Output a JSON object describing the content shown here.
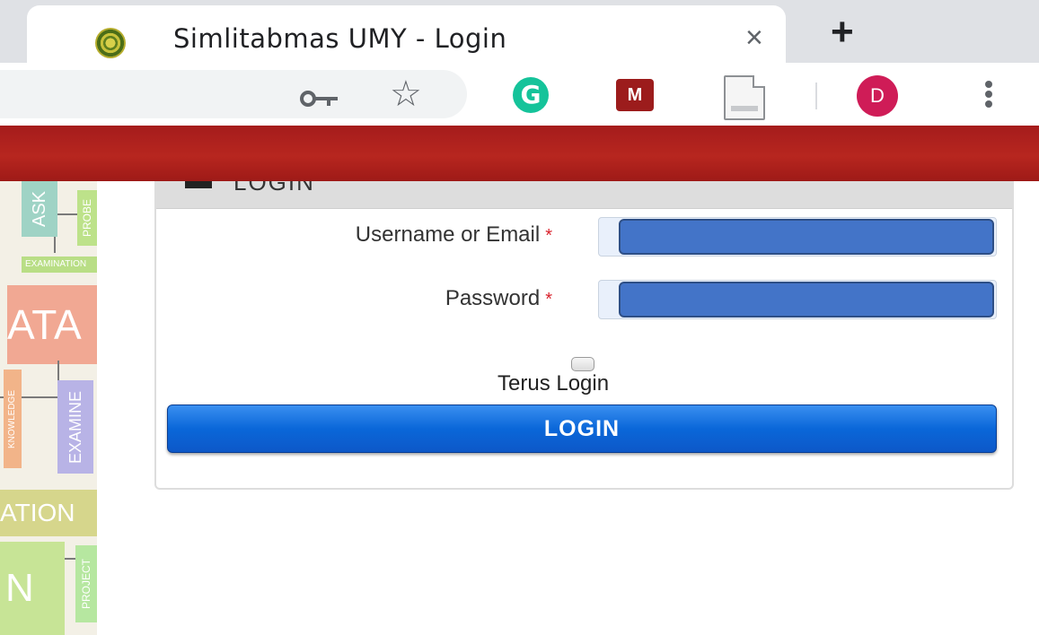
{
  "browser": {
    "tab_title": "Simlitabmas UMY - Login",
    "tab_close_glyph": "×",
    "new_tab_glyph": "+",
    "profile_initial": "D",
    "grammarly_letter": "G",
    "mendeley_glyph": "M",
    "icons": [
      "umy-favicon",
      "key-icon",
      "star-icon",
      "grammarly-icon",
      "mendeley-icon",
      "page-icon",
      "avatar",
      "menu-icon"
    ]
  },
  "colors": {
    "header_red": "#b7261f",
    "button_blue": "#0a67d9",
    "input_fill": "#4374c8",
    "required_star": "#d9232d",
    "avatar": "#cf1c57",
    "grammarly": "#15c39a"
  },
  "background_words": [
    "ASK",
    "PROBE",
    "EXAMINATION",
    "ATA",
    "KNOWLEDGE",
    "EXAMINE",
    "ATION",
    "N",
    "PROJECT"
  ],
  "login": {
    "panel_heading": "LOGIN",
    "username_label": "Username or Email",
    "password_label": "Password",
    "required_marker": "*",
    "remember_label": "Terus Login",
    "submit_label": "LOGIN"
  }
}
